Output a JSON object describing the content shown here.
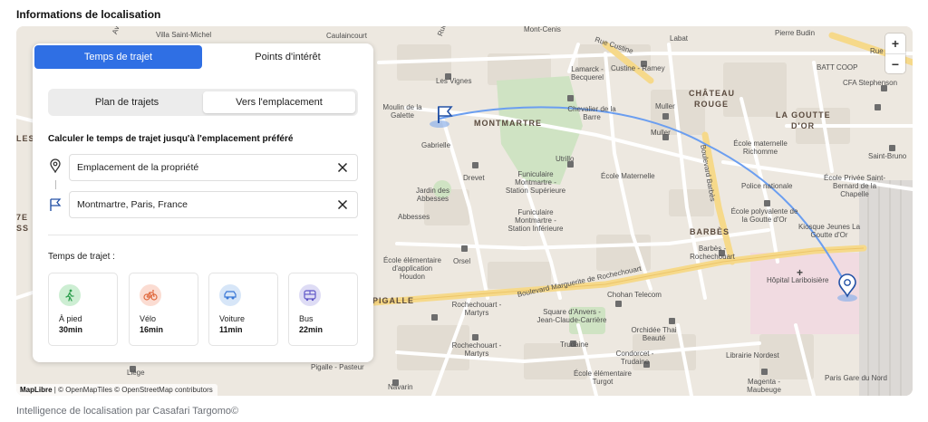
{
  "section_title": "Informations de localisation",
  "footer": "Intelligence de localisation par Casafari Targomo©",
  "map": {
    "attribution_brand": "MapLibre",
    "attribution_rest": " | © OpenMapTiles © OpenStreetMap contributors",
    "zoom_in": "+",
    "zoom_out": "−",
    "labels": {
      "l1": "Villa Saint-Michel",
      "l2": "Caulaincourt",
      "l3": "Mont-Cenis",
      "l4": "Labat",
      "l5": "Pierre Budin",
      "l6": "Rue D",
      "l7": "Les Vignes",
      "l8": "Lamarck - Becquerel",
      "l9": "Custine - Ramey",
      "l10": "BATT COOP",
      "l11": "CFA Stephenson",
      "l12": "Moulin de la Galette",
      "l13": "MONTMARTRE",
      "l14": "Chevalier de la Barre",
      "l15": "CHÂTEAU",
      "l16": "ROUGE",
      "l17": "LA GOUTTE",
      "l18": "D'OR",
      "l19": "Gabrielle",
      "l20": "Muller",
      "l21": "Muller",
      "l22": "École maternelle Richomme",
      "l23": "Saint-Bruno",
      "l24": "Utrillo",
      "l25": "Drevet",
      "l26": "Funiculaire Montmartre - Station Supérieure",
      "l27": "École Maternelle",
      "l28": "Police nationale",
      "l29": "École Privée Saint-Bernard de la Chapelle",
      "l30": "Jardin des Abbesses",
      "l31": "Abbesses",
      "l32": "Funiculaire Montmartre - Station Inférieure",
      "l33": "École polyvalente de la Goutte d'Or",
      "l34": "Kiosque Jeunes La Goutte d'Or",
      "l35": "BARBÈS",
      "l36": "Barbès - Rochechouart",
      "l37": "École élémentaire d'application Houdon",
      "l38": "Orsel",
      "l39": "Boulevard Marguerite de Rochechouart",
      "l40": "Hôpital Lariboisière",
      "l41": "PIGALLE",
      "l42": "Rochechouart - Martyrs",
      "l43": "Chohan Telecom",
      "l44": "Square d'Anvers - Jean-Claude-Carrière",
      "l45": "Orchidée Thai Beauté",
      "l46": "Rochechouart - Martyrs",
      "l47": "Trudaine",
      "l48": "Condorcet - Trudaine",
      "l49": "Librairie Nordest",
      "l50": "Liège",
      "l51": "Pigalle - Pasteur",
      "l52": "École élémentaire Turgot",
      "l53": "Navarin",
      "l54": "Magenta - Maubeuge",
      "l55": "Paris Gare du Nord",
      "l56": "Boulevard Barbès",
      "l57": "Rue Custine",
      "l58": "Avenue",
      "l59": "Rue",
      "l60": "LES",
      "l61": "7E",
      "l62": "SS"
    }
  },
  "panel": {
    "tabs": [
      {
        "label": "Temps de trajet",
        "active": true
      },
      {
        "label": "Points d'intérêt",
        "active": false
      }
    ],
    "segments": [
      {
        "label": "Plan de trajets",
        "active": false
      },
      {
        "label": "Vers l'emplacement",
        "active": true
      }
    ],
    "calc_title": "Calculer le temps de trajet jusqu'à l'emplacement préféré",
    "origin": "Emplacement de la propriété",
    "destination": "Montmartre, Paris, France",
    "travel_time_title": "Temps de trajet :",
    "modes": [
      {
        "label": "À pied",
        "value": "30min",
        "icon": "walk-icon",
        "color": "#cdeed3",
        "fg": "#2e9f4f"
      },
      {
        "label": "Vélo",
        "value": "16min",
        "icon": "bike-icon",
        "color": "#fbdcd2",
        "fg": "#e06a3f"
      },
      {
        "label": "Voiture",
        "value": "11min",
        "icon": "car-icon",
        "color": "#d7e6f8",
        "fg": "#3a78d6"
      },
      {
        "label": "Bus",
        "value": "22min",
        "icon": "bus-icon",
        "color": "#dedcf5",
        "fg": "#5f56c7"
      }
    ]
  }
}
